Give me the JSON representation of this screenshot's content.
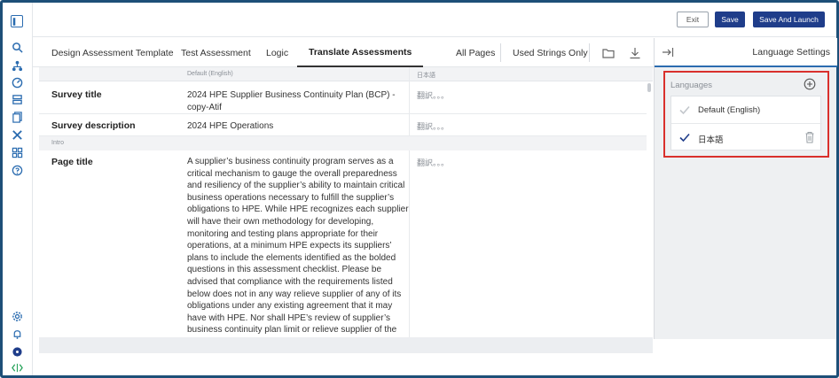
{
  "toolbar": {
    "exit_label": "Exit",
    "save_label": "Save",
    "save_launch_label": "Save And Launch"
  },
  "tabs": [
    {
      "label": "Design Assessment Template",
      "active": false
    },
    {
      "label": "Test Assessment",
      "active": false
    },
    {
      "label": "Logic",
      "active": false
    },
    {
      "label": "Translate Assessments",
      "active": true
    }
  ],
  "filters": {
    "all_pages": "All Pages",
    "used_strings": "Used Strings Only"
  },
  "table": {
    "col_default": "Default (English)",
    "col_translation": "日本語",
    "rows": [
      {
        "label": "Survey title",
        "source": "2024 HPE Supplier Business Continuity Plan (BCP) - copy-Atif",
        "translation": "翻訳。。。"
      },
      {
        "label": "Survey description",
        "source": "2024 HPE Operations",
        "translation": "翻訳。。。"
      }
    ],
    "section": "Intro",
    "page_row": {
      "label": "Page title",
      "source": "A supplier’s business continuity program serves as a critical mechanism to gauge the overall preparedness and resiliency of the supplier’s ability to maintain critical business operations necessary to fulfill the supplier’s obligations to HPE.   While HPE recognizes each supplier will have their own methodology for developing, monitoring and testing plans appropriate for their operations, at a minimum HPE expects its suppliers’ plans to include the elements identified as the bolded questions in this assessment  checklist.    Please be advised that compliance with the requirements listed below does not in any way relieve supplier of any of its obligations under any existing agreement that it may have with HPE. Nor shall HPE’s review of supplier’s business continuity plan limit or relieve supplier of the duty or responsibility to confirm the appropriate plans are in place to ensure seamless delivery",
      "translation": "翻訳。。。"
    }
  },
  "right_panel": {
    "title": "Language Settings",
    "languages_label": "Languages",
    "languages": [
      {
        "name": "Default (English)",
        "checked": true,
        "disabled": true
      },
      {
        "name": "日本語",
        "checked": true,
        "disabled": false
      }
    ]
  },
  "colors": {
    "primary": "#1f3d8a",
    "highlight": "#d9302c",
    "accent": "#2b6cb0",
    "frame": "#1d4f78"
  }
}
